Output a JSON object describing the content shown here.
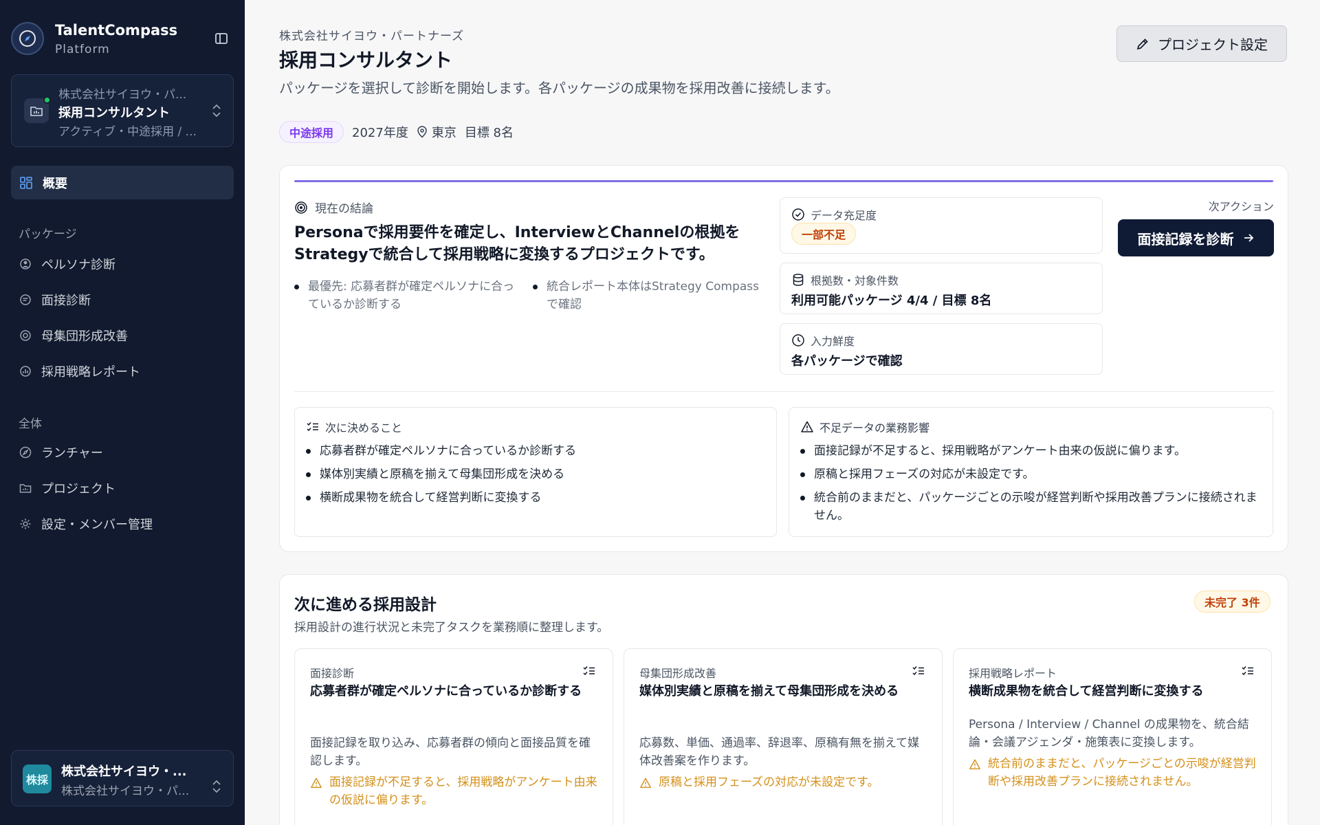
{
  "sidebar": {
    "brand_name": "TalentCompass",
    "brand_sub": "Platform",
    "project_switcher": {
      "company": "株式会社サイヨウ・パ...",
      "name": "採用コンサルタント",
      "status": "アクティブ・中途採用 / ..."
    },
    "nav_active": "概要",
    "section_packages": "パッケージ",
    "packages": [
      "ペルソナ診断",
      "面接診断",
      "母集団形成改善",
      "採用戦略レポート"
    ],
    "section_all": "全体",
    "global": [
      "ランチャー",
      "プロジェクト",
      "設定・メンバー管理"
    ],
    "org": {
      "avatar": "株採",
      "name": "株式会社サイヨウ・...",
      "sub": "株式会社サイヨウ・パ..."
    }
  },
  "header": {
    "company": "株式会社サイヨウ・パートナーズ",
    "title": "採用コンサルタント",
    "description": "パッケージを選択して診断を開始します。各パッケージの成果物を採用改善に接続します。",
    "settings_button": "プロジェクト設定",
    "meta": {
      "badge": "中途採用",
      "year": "2027年度",
      "location": "東京",
      "target": "目標 8名"
    }
  },
  "conclusion": {
    "label": "現在の結論",
    "text": "Personaで採用要件を確定し、InterviewとChannelの根拠をStrategyで統合して採用戦略に変換するプロジェクトです。",
    "bullets": [
      "最優先: 応募者群が確定ペルソナに合っているか診断する",
      "統合レポート本体はStrategy Compassで確認"
    ],
    "metrics": {
      "data_label": "データ充足度",
      "data_badge": "一部不足",
      "evidence_label": "根拠数・対象件数",
      "evidence_value": "利用可能パッケージ 4/4 / 目標 8名",
      "freshness_label": "入力鮮度",
      "freshness_value": "各パッケージで確認"
    },
    "next_action_label": "次アクション",
    "next_action_button": "面接記録を診断",
    "decide": {
      "title": "次に決めること",
      "items": [
        "応募者群が確定ペルソナに合っているか診断する",
        "媒体別実績と原稿を揃えて母集団形成を決める",
        "横断成果物を統合して経営判断に変換する"
      ]
    },
    "impact": {
      "title": "不足データの業務影響",
      "items": [
        "面接記録が不足すると、採用戦略がアンケート由来の仮説に偏ります。",
        "原稿と採用フェーズの対応が未設定です。",
        "統合前のままだと、パッケージごとの示唆が経営判断や採用改善プランに接続されません。"
      ]
    }
  },
  "design": {
    "title": "次に進める採用設計",
    "subtitle": "採用設計の進行状況と未完了タスクを業務順に整理します。",
    "badge": "未完了 3件",
    "tasks": [
      {
        "category": "面接診断",
        "title": "応募者群が確定ペルソナに合っているか診断する",
        "desc": "面接記録を取り込み、応募者群の傾向と面接品質を確認します。",
        "warn": "面接記録が不足すると、採用戦略がアンケート由来の仮説に偏ります。"
      },
      {
        "category": "母集団形成改善",
        "title": "媒体別実績と原稿を揃えて母集団形成を決める",
        "desc": "応募数、単価、通過率、辞退率、原稿有無を揃えて媒体改善案を作ります。",
        "warn": "原稿と採用フェーズの対応が未設定です。"
      },
      {
        "category": "採用戦略レポート",
        "title": "横断成果物を統合して経営判断に変換する",
        "desc": "Persona / Interview / Channel の成果物を、統合結論・会議アジェンダ・施策表に変換します。",
        "warn": "統合前のままだと、パッケージごとの示唆が経営判断や採用改善プランに接続されません。"
      }
    ]
  },
  "colors": {
    "sidebar_bg": "#111a2e",
    "accent_purple": "#7c6ee6",
    "primary_button": "#0f1b35",
    "warning_amber": "#d4901a",
    "status_green": "#22c55e"
  }
}
